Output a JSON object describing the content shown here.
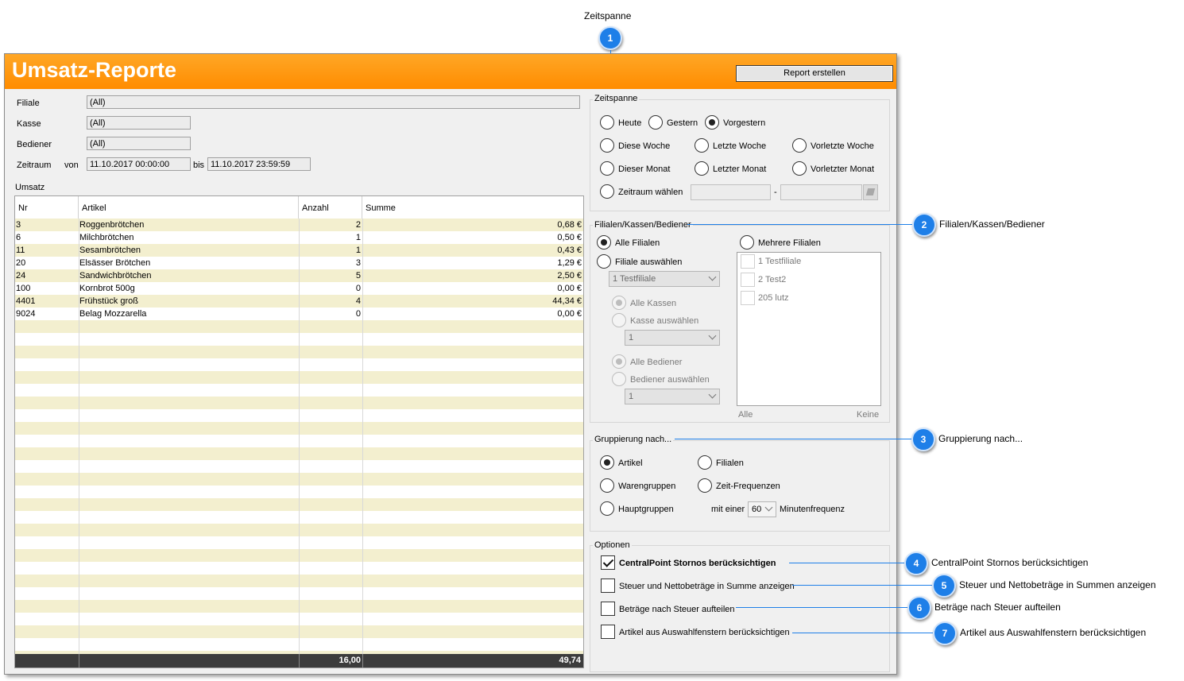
{
  "app": {
    "title": "Umsatz-Reporte",
    "report_button": "Report erstellen"
  },
  "filters": {
    "filiale_label": "Filiale",
    "filiale_value": "(All)",
    "kasse_label": "Kasse",
    "kasse_value": "(All)",
    "bediener_label": "Bediener",
    "bediener_value": "(All)",
    "zeitraum_label": "Zeitraum",
    "von_label": "von",
    "von_value": "11.10.2017  00:00:00",
    "bis_label": "bis",
    "bis_value": "11.10.2017  23:59:59"
  },
  "umsatz": {
    "group_title": "Umsatz",
    "columns": [
      "Nr",
      "Artikel",
      "Anzahl",
      "Summe"
    ],
    "rows": [
      {
        "nr": "3",
        "artikel": "Roggenbrötchen",
        "anzahl": "2",
        "summe": "0,68 €"
      },
      {
        "nr": "6",
        "artikel": "Milchbrötchen",
        "anzahl": "1",
        "summe": "0,50 €"
      },
      {
        "nr": "11",
        "artikel": "Sesambrötchen",
        "anzahl": "1",
        "summe": "0,43 €"
      },
      {
        "nr": "20",
        "artikel": "Elsässer Brötchen",
        "anzahl": "3",
        "summe": "1,29 €"
      },
      {
        "nr": "24",
        "artikel": "Sandwichbrötchen",
        "anzahl": "5",
        "summe": "2,50 €"
      },
      {
        "nr": "100",
        "artikel": "Kornbrot 500g",
        "anzahl": "0",
        "summe": "0,00 €"
      },
      {
        "nr": "4401",
        "artikel": "Frühstück groß",
        "anzahl": "4",
        "summe": "44,34 €"
      },
      {
        "nr": "9024",
        "artikel": "Belag Mozzarella",
        "anzahl": "0",
        "summe": "0,00 €"
      }
    ],
    "total_anzahl": "16,00",
    "total_summe": "49,74"
  },
  "zeitspanne": {
    "title": "Zeitspanne",
    "options": [
      "Heute",
      "Gestern",
      "Vorgestern",
      "Diese Woche",
      "Letzte Woche",
      "Vorletzte Woche",
      "Dieser Monat",
      "Letzter Monat",
      "Vorletzter Monat",
      "Zeitraum wählen"
    ],
    "selected": "Vorgestern",
    "range_separator": "-"
  },
  "filialen": {
    "title": "Filialen/Kassen/Bediener",
    "alle_filialen": "Alle Filialen",
    "filiale_auswaehlen": "Filiale auswählen",
    "mehrere_filialen": "Mehrere Filialen",
    "filiale_combo": "1 Testfiliale",
    "alle_kassen": "Alle Kassen",
    "kasse_auswaehlen": "Kasse auswählen",
    "kasse_combo": "1",
    "alle_bediener": "Alle Bediener",
    "bediener_auswaehlen": "Bediener auswählen",
    "bediener_combo": "1",
    "list_items": [
      "1 Testfiliale",
      "2 Test2",
      "205 lutz"
    ],
    "alle_link": "Alle",
    "keine_link": "Keine"
  },
  "gruppierung": {
    "title": "Gruppierung nach...",
    "artikel": "Artikel",
    "filialen": "Filialen",
    "warengruppen": "Warengruppen",
    "zeit_frequenzen": "Zeit-Frequenzen",
    "hauptgruppen": "Hauptgruppen",
    "mit_einer": "mit einer",
    "frequenz_value": "60",
    "minutenfrequenz": "Minutenfrequenz"
  },
  "optionen": {
    "title": "Optionen",
    "opt1": "CentralPoint Stornos berücksichtigen",
    "opt2": "Steuer und Nettobeträge in Summe anzeigen",
    "opt3": "Beträge nach Steuer aufteilen",
    "opt4": "Artikel aus Auswahlfenstern berücksichtigen"
  },
  "callouts": {
    "c1_num": "1",
    "c1_label": "Zeitspanne",
    "c2_num": "2",
    "c2_label": "Filialen/Kassen/Bediener",
    "c3_num": "3",
    "c3_label": "Gruppierung nach...",
    "c4_num": "4",
    "c4_label": "CentralPoint Stornos berücksichtigen",
    "c5_num": "5",
    "c5_label": "Steuer und Nettobeträge in Summen anzeigen",
    "c6_num": "6",
    "c6_label": "Beträge nach Steuer aufteilen",
    "c7_num": "7",
    "c7_label": "Artikel aus Auswahlfenstern berücksichtigen"
  },
  "colors": {
    "title_bar": "#ff8c00",
    "callout": "#1e7fe8",
    "row_alt": "#f3efcf"
  }
}
